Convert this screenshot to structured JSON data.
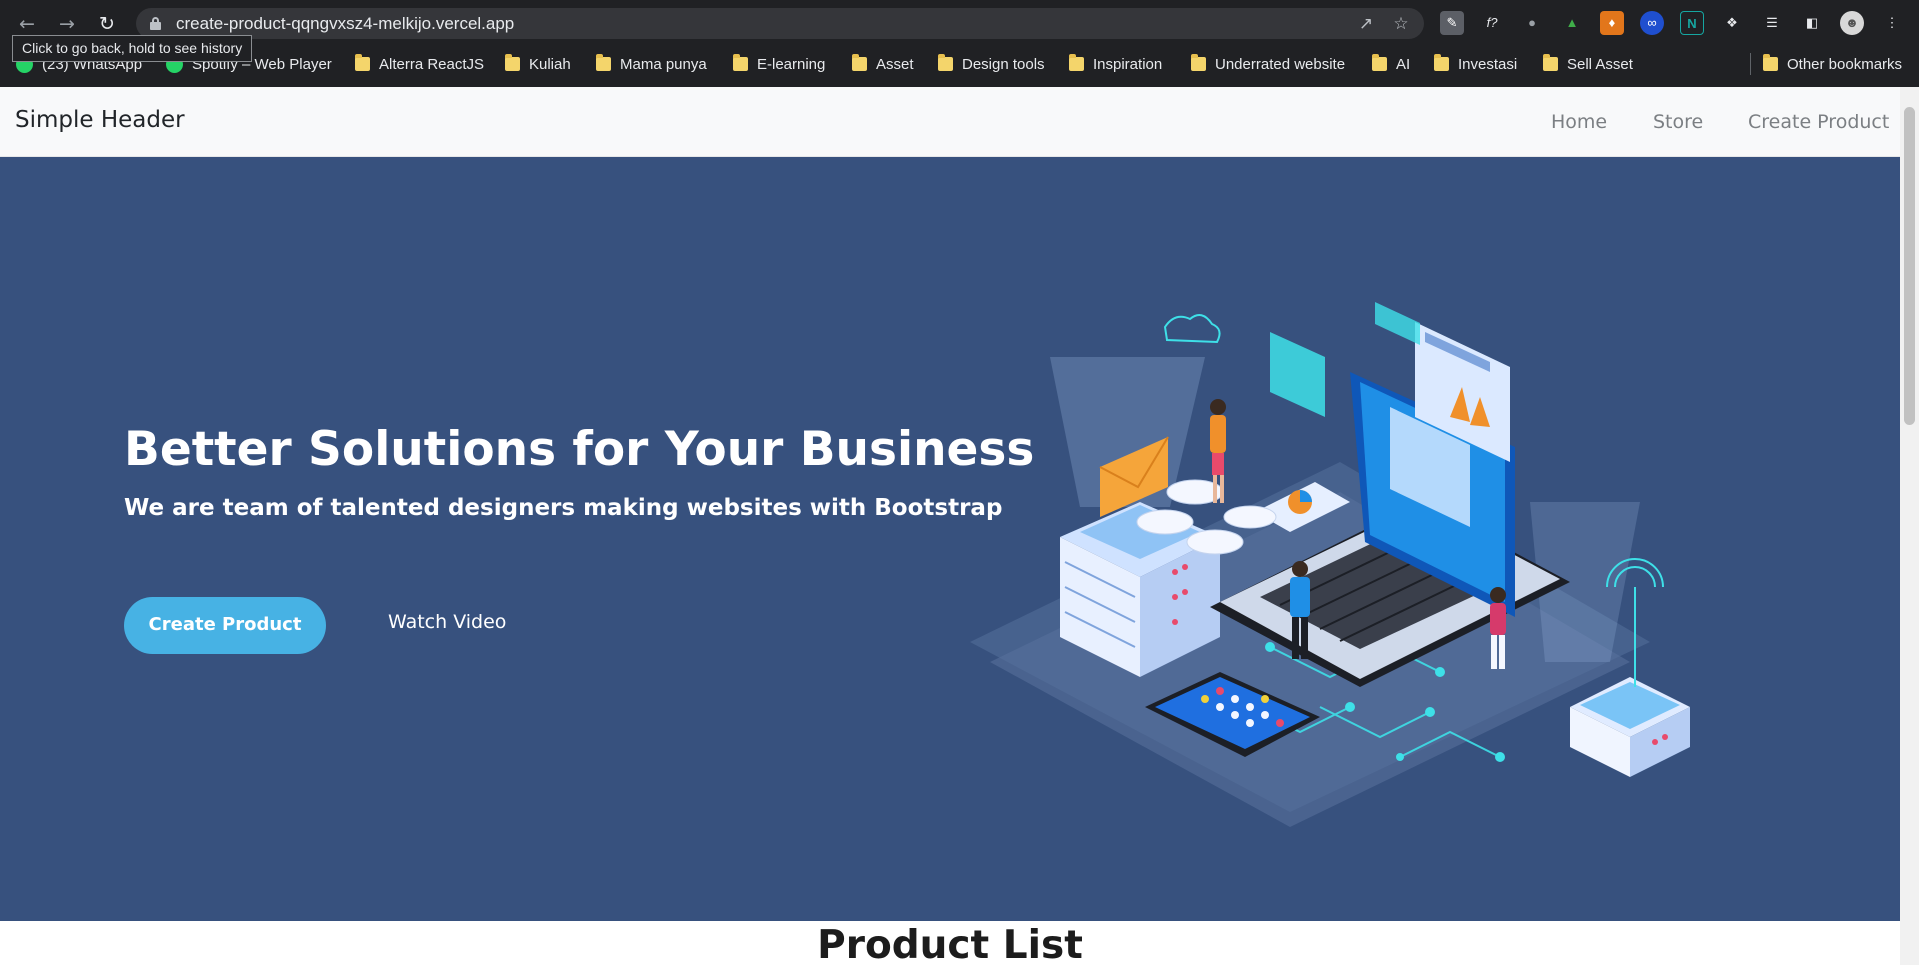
{
  "browser": {
    "url": "create-product-qqngvxsz4-melkijo.vercel.app",
    "tooltip": "Click to go back, hold to see history",
    "bookmarks": [
      {
        "label": "(23) WhatsApp",
        "icon": "whatsapp-icon"
      },
      {
        "label": "Spotify – Web Player",
        "icon": "spotify-icon"
      },
      {
        "label": "Alterra ReactJS",
        "icon": "folder-icon"
      },
      {
        "label": "Kuliah",
        "icon": "folder-icon"
      },
      {
        "label": "Mama punya",
        "icon": "folder-icon"
      },
      {
        "label": "E-learning",
        "icon": "folder-icon"
      },
      {
        "label": "Asset",
        "icon": "folder-icon"
      },
      {
        "label": "Design tools",
        "icon": "folder-icon"
      },
      {
        "label": "Inspiration",
        "icon": "folder-icon"
      },
      {
        "label": "Underrated website",
        "icon": "folder-icon"
      },
      {
        "label": "AI",
        "icon": "folder-icon"
      },
      {
        "label": "Investasi",
        "icon": "folder-icon"
      },
      {
        "label": "Sell Asset",
        "icon": "folder-icon"
      }
    ],
    "other_bookmarks": "Other bookmarks"
  },
  "header": {
    "brand": "Simple Header",
    "nav": [
      "Home",
      "Store",
      "Create Product"
    ]
  },
  "hero": {
    "title": "Better Solutions for Your Business",
    "subtitle": "We are team of talented designers making websites with Bootstrap",
    "primary_button": "Create Product",
    "secondary_button": "Watch Video",
    "background_color": "#37517e",
    "button_color": "#47b2e4"
  },
  "products": {
    "title": "Product List"
  }
}
